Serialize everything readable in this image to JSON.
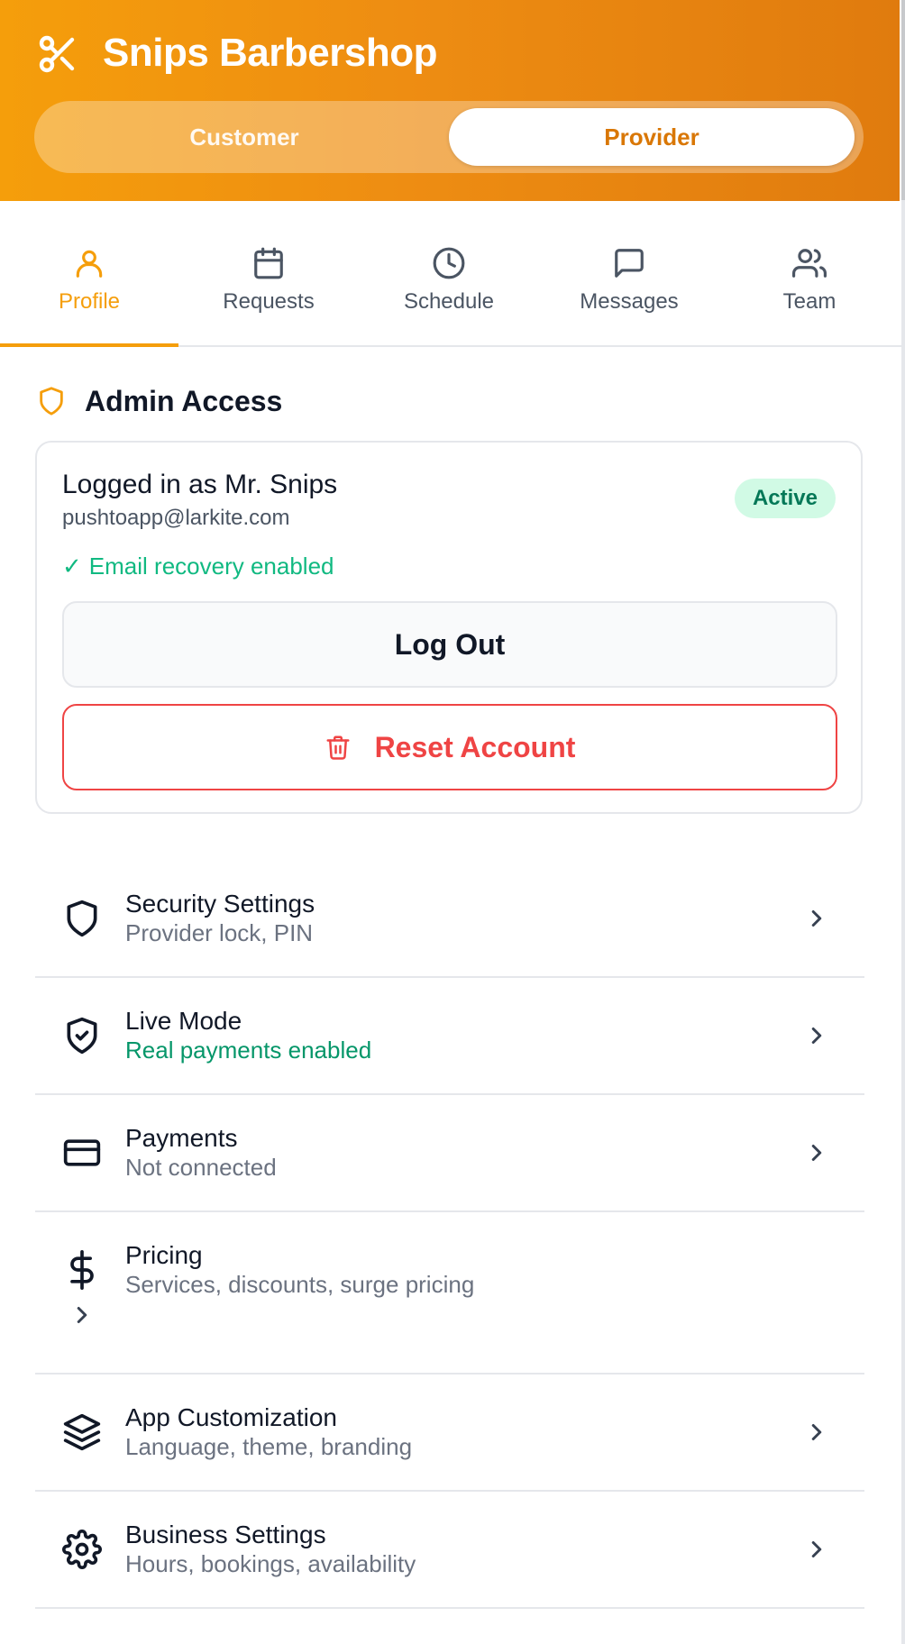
{
  "app": {
    "title": "Snips Barbershop",
    "brand_icon": "scissors-icon",
    "accent_color": "#f59e0b",
    "mode_switch": {
      "options": [
        "Customer",
        "Provider"
      ],
      "selected": "Provider"
    }
  },
  "tabs": [
    {
      "label": "Profile",
      "icon": "user-icon",
      "active": true
    },
    {
      "label": "Requests",
      "icon": "calendar-icon",
      "active": false
    },
    {
      "label": "Schedule",
      "icon": "clock-icon",
      "active": false
    },
    {
      "label": "Messages",
      "icon": "message-icon",
      "active": false
    },
    {
      "label": "Team",
      "icon": "users-icon",
      "active": false
    }
  ],
  "admin": {
    "section_title": "Admin Access",
    "section_icon": "shield-icon",
    "logged_in_as": "Logged in as Mr. Snips",
    "email": "pushtoapp@larkite.com",
    "status": "Active",
    "status_color": "#047857",
    "recovery_check": "✓",
    "recovery_text": "Email recovery enabled",
    "logout_label": "Log Out",
    "reset_label": "Reset Account",
    "reset_color": "#ef4444"
  },
  "settings": [
    {
      "title": "Security Settings",
      "subtitle": "Provider lock, PIN",
      "icon": "shield-icon"
    },
    {
      "title": "Live Mode",
      "subtitle": "Real payments enabled",
      "icon": "shield-check-icon",
      "subtitle_color": "#059669"
    },
    {
      "title": "Payments",
      "subtitle": "Not connected",
      "icon": "credit-card-icon"
    },
    {
      "title": "Pricing",
      "subtitle": "Services, discounts, surge pricing",
      "icon": "dollar-icon"
    },
    {
      "title": "App Customization",
      "subtitle": "Language, theme, branding",
      "icon": "layers-icon"
    },
    {
      "title": "Business Settings",
      "subtitle": "Hours, bookings, availability",
      "icon": "gear-icon"
    }
  ]
}
